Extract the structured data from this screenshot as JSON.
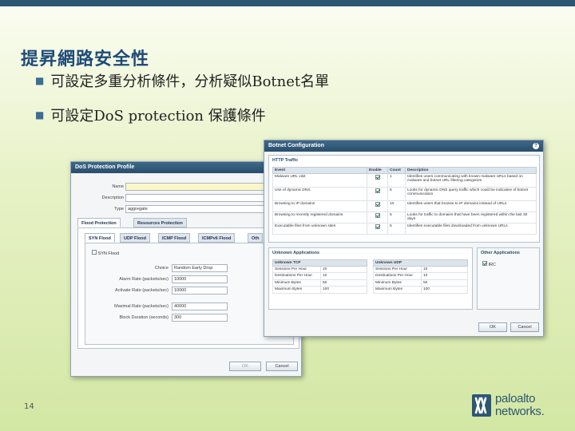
{
  "slide": {
    "title": "提昇網路安全性",
    "bullets": [
      "可設定多重分析條件，分析疑似Botnet名單",
      "可設定DoS protection 保護條件"
    ],
    "bullet_mark": "■",
    "page_number": "14"
  },
  "logo": {
    "line1": "paloalto",
    "line2": "networks."
  },
  "dos_dialog": {
    "title": "DoS Protection Profile",
    "name_label": "Name",
    "name_value": "",
    "description_label": "Description",
    "description_value": "",
    "type_label": "Type",
    "type_value": "aggregate",
    "main_tabs": [
      "Flood Protection",
      "Resources Protection"
    ],
    "sub_tabs": [
      "SYN Flood",
      "UDP Flood",
      "ICMP Flood",
      "ICMPv6 Flood",
      "Oth"
    ],
    "syn_flood_checkbox": "SYN Flood",
    "fields": [
      {
        "label": "Choice",
        "value": "Random Early Drop"
      },
      {
        "label": "Alarm Rate (packets/sec)",
        "value": "10000"
      },
      {
        "label": "Activate Rate (packets/sec)",
        "value": "10000"
      },
      {
        "label": "Maximal Rate (packets/sec)",
        "value": "40000"
      },
      {
        "label": "Block Duration (seconds)",
        "value": "300"
      }
    ],
    "ok_label": "OK",
    "cancel_label": "Cancel"
  },
  "botnet_dialog": {
    "title": "Botnet Configuration",
    "help_icon": "?",
    "http_group": "HTTP Traffic",
    "http_headers": [
      "Event",
      "Enable",
      "Count",
      "Description"
    ],
    "http_rows": [
      {
        "event": "Malware URL visit",
        "enabled": true,
        "count": "1",
        "description": "Identifies users communicating with known malware URLs based on malware and botnet URL filtering categories"
      },
      {
        "event": "Use of dynamic DNS",
        "enabled": true,
        "count": "5",
        "description": "Looks for dynamic DNS query traffic which could be indicative of botnet communication"
      },
      {
        "event": "Browsing to IP domains",
        "enabled": true,
        "count": "10",
        "description": "Identifies users that browse to IP domains instead of URLs"
      },
      {
        "event": "Browsing to recently registered domains",
        "enabled": true,
        "count": "5",
        "description": "Looks for traffic to domains that have been registered within the last 30 days"
      },
      {
        "event": "Executable files from unknown sites",
        "enabled": true,
        "count": "5",
        "description": "Identifies executable files downloaded from unknown URLs"
      }
    ],
    "unknown_group": "Unknown Applications",
    "unknown_tcp": {
      "header": "Unknown TCP",
      "rows": [
        {
          "label": "Sessions Per Hour",
          "value": "10"
        },
        {
          "label": "Destinations Per Hour",
          "value": "10"
        },
        {
          "label": "Minimum Bytes",
          "value": "50"
        },
        {
          "label": "Maximum Bytes",
          "value": "100"
        }
      ]
    },
    "unknown_udp": {
      "header": "Unknown UDP",
      "rows": [
        {
          "label": "Sessions Per Hour",
          "value": "10"
        },
        {
          "label": "Destinations Per Hour",
          "value": "10"
        },
        {
          "label": "Minimum Bytes",
          "value": "50"
        },
        {
          "label": "Maximum Bytes",
          "value": "100"
        }
      ]
    },
    "other_group": "Other Applications",
    "irc_label": "IRC",
    "irc_enabled": true,
    "ok_label": "OK",
    "cancel_label": "Cancel"
  }
}
